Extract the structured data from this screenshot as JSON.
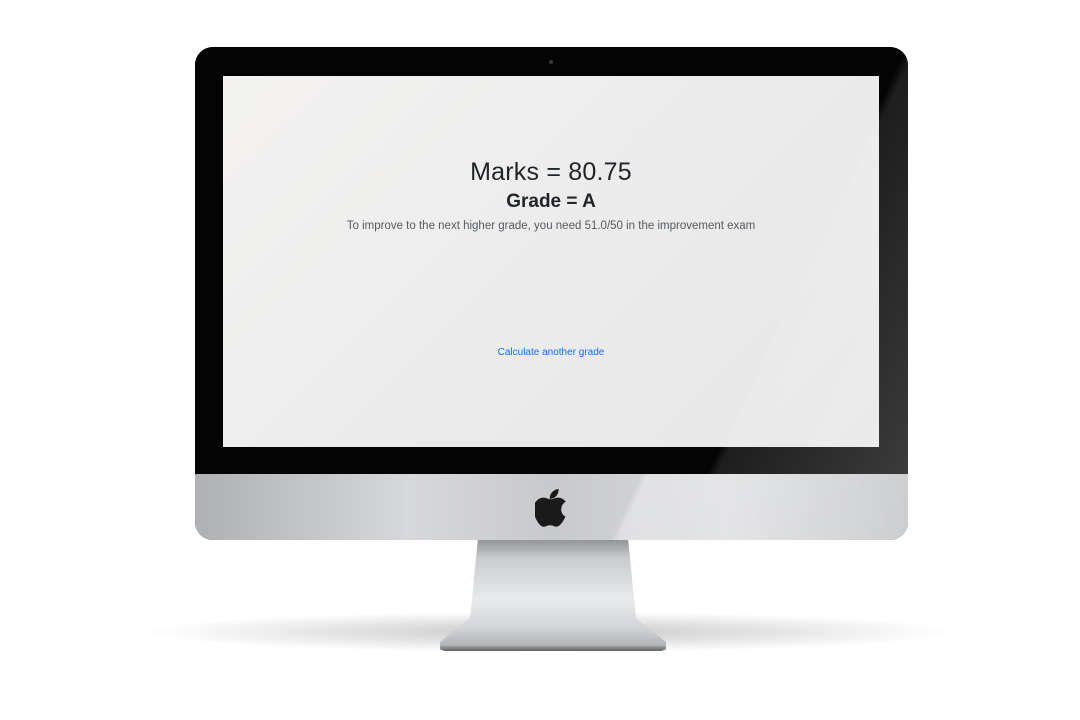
{
  "result": {
    "marks_text": "Marks = 80.75",
    "grade_text": "Grade = A",
    "hint_text": "To improve to the next higher grade, you need 51.0/50 in the improvement exam"
  },
  "actions": {
    "calculate_again_label": "Calculate another grade"
  },
  "icons": {
    "device_logo": "apple-logo-icon"
  },
  "colors": {
    "text": "#212529",
    "hint": "#555a5f",
    "link": "#0d6efd",
    "screen_background": "#ececec"
  }
}
